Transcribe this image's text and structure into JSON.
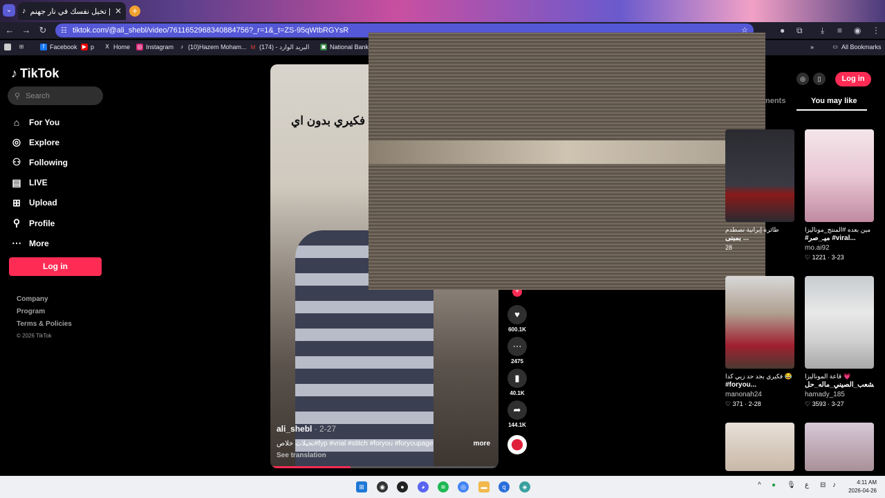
{
  "browser": {
    "tab_title": "تخيل نفسك في نار جهنم | TikTok",
    "url": "tiktok.com/@ali_shebl/video/7611652968340884756?_r=1&_t=ZS-95qWtbRGYsR",
    "all_bookmarks": "All Bookmarks",
    "bookmarks": [
      "Facebook",
      "p",
      "Home",
      "Instagram",
      "(10)Hazem Moham...",
      "(174) - البريد الوارد",
      "National Bank O"
    ]
  },
  "sidebar": {
    "logo": "TikTok",
    "search_placeholder": "Search",
    "nav": [
      {
        "label": "For You",
        "icon": "home-icon"
      },
      {
        "label": "Explore",
        "icon": "compass-icon"
      },
      {
        "label": "Following",
        "icon": "following-icon"
      },
      {
        "label": "LIVE",
        "icon": "live-icon"
      },
      {
        "label": "Upload",
        "icon": "upload-icon"
      },
      {
        "label": "Profile",
        "icon": "profile-icon"
      },
      {
        "label": "More",
        "icon": "more-icon"
      }
    ],
    "login": "Log in",
    "footer": [
      "Company",
      "Program",
      "Terms & Policies"
    ],
    "copyright": "© 2026 TikTok"
  },
  "video": {
    "overlay_text": "فكيري بدون اي",
    "username": "ali_shebl",
    "date": "· 2-27",
    "description": "تخيلات خلاص#fyp #vrial #stitch #foryou #foryoupage",
    "more": "more",
    "see_translation": "See translation",
    "progress": 0.35
  },
  "actions": {
    "likes": "600.1K",
    "comments": "2475",
    "saves": "40.1K",
    "shares": "144.1K"
  },
  "right_panel": {
    "login": "Log in",
    "tab_comments": "nents",
    "tab_you_may_like": "You may like",
    "cards": [
      {
        "title": "طائرة إيرانية تصطدم",
        "title2": "بمبنى ...",
        "author": "",
        "stats": "28"
      },
      {
        "title": "مين بعده #المنتج_موناليزا",
        "title2": "#ميـ_صر #viral...",
        "author": "mo.ai92",
        "stats": "1221 · 3-23"
      },
      {
        "title": "فكيري بجد حد زيي كدا 😂",
        "title2": "#foryou...",
        "author": "manonah24",
        "stats": "371 · 2-28"
      },
      {
        "title": "قاعة الموناليزا 💗",
        "title2": "الشعب_الصيني_ماله_حل...",
        "author": "hamady_185",
        "stats": "3593 · 3-27"
      }
    ]
  },
  "taskbar": {
    "time": "4:11 AM",
    "date": "2026-04-26",
    "lang": "ع"
  }
}
